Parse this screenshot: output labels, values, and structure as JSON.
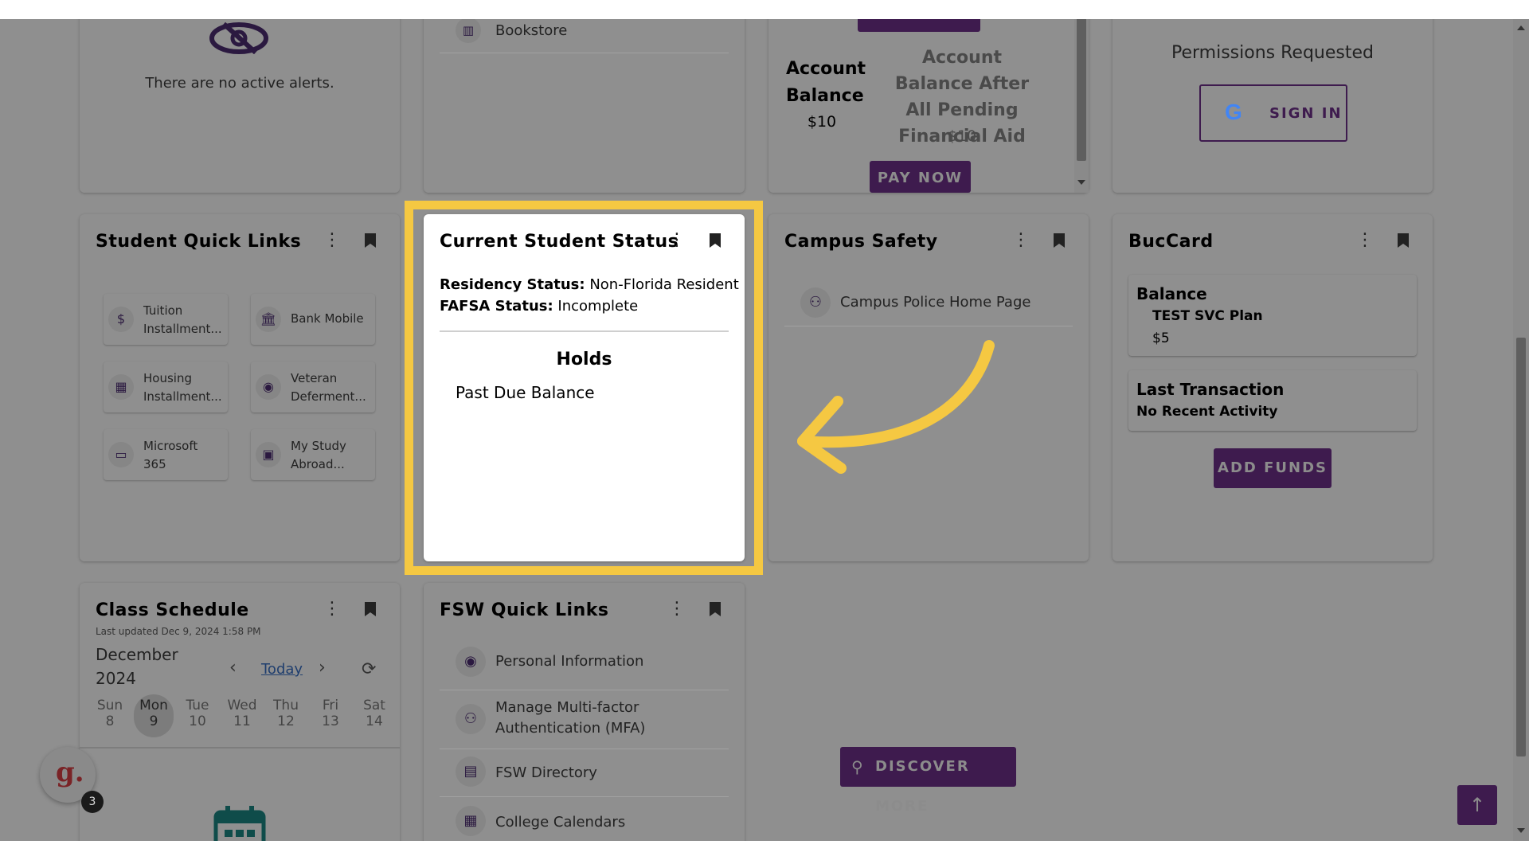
{
  "alerts": {
    "message": "There are no active alerts."
  },
  "bookstore": {
    "label": "Bookstore"
  },
  "account": {
    "balance_label": "Account Balance",
    "balance_value": "$10",
    "pending_label": "Account Balance After All Pending Financial Aid",
    "pending_value": "$10",
    "pay_now": "PAY NOW"
  },
  "permissions": {
    "title": "Permissions Requested",
    "sign_in": "SIGN IN"
  },
  "student_quick_links": {
    "title": "Student Quick Links",
    "items": [
      {
        "label": "Tuition Installment...",
        "icon": "dollar-icon",
        "glyph": "$"
      },
      {
        "label": "Bank Mobile",
        "icon": "bank-icon",
        "glyph": "🏛"
      },
      {
        "label": "Housing Installment...",
        "icon": "building-icon",
        "glyph": "▦"
      },
      {
        "label": "Veteran Deferment...",
        "icon": "person-icon",
        "glyph": "◉"
      },
      {
        "label": "Microsoft 365",
        "icon": "laptop-icon",
        "glyph": "▭"
      },
      {
        "label": "My Study Abroad...",
        "icon": "passport-icon",
        "glyph": "▣"
      }
    ]
  },
  "student_status": {
    "title": "Current Student Status",
    "residency_label": "Residency Status:",
    "residency_value": "Non-Florida Resident",
    "fafsa_label": "FAFSA Status:",
    "fafsa_value": "Incomplete",
    "holds_title": "Holds",
    "holds": [
      "Past Due Balance"
    ]
  },
  "campus_safety": {
    "title": "Campus Safety",
    "link": "Campus Police Home Page"
  },
  "buccard": {
    "title": "BucCard",
    "balance_title": "Balance",
    "plan": "TEST SVC Plan",
    "plan_amount": "$5",
    "last_transaction_title": "Last Transaction",
    "last_transaction_value": "No Recent Activity",
    "add_funds": "ADD FUNDS"
  },
  "class_schedule": {
    "title": "Class Schedule",
    "last_updated": "Last updated Dec 9, 2024 1:58 PM",
    "month": "December",
    "year": "2024",
    "today_label": "Today",
    "days": [
      {
        "name": "Sun",
        "num": "8"
      },
      {
        "name": "Mon",
        "num": "9"
      },
      {
        "name": "Tue",
        "num": "10"
      },
      {
        "name": "Wed",
        "num": "11"
      },
      {
        "name": "Thu",
        "num": "12"
      },
      {
        "name": "Fri",
        "num": "13"
      },
      {
        "name": "Sat",
        "num": "14"
      }
    ]
  },
  "fsw_quick_links": {
    "title": "FSW Quick Links",
    "items": [
      {
        "label": "Personal Information",
        "icon": "person-circle-icon"
      },
      {
        "label": "Manage Multi-factor Authentication (MFA)",
        "icon": "user-key-icon"
      },
      {
        "label": "FSW Directory",
        "icon": "id-card-icon"
      },
      {
        "label": "College Calendars",
        "icon": "calendar-icon"
      }
    ]
  },
  "discover_more": "DISCOVER MORE",
  "guidde": {
    "letter": "g.",
    "badge": "3"
  },
  "colors": {
    "purple": "#3e1b4e",
    "highlight": "#f5c842",
    "overlay_gray": "#8f8f8f"
  }
}
